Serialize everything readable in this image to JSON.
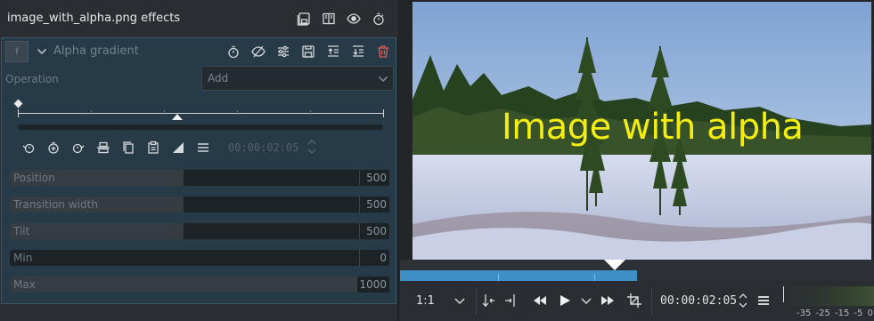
{
  "effects_panel": {
    "title": "image_with_alpha.png effects",
    "header_icons": [
      "save-stack-icon",
      "compare-split-icon",
      "visibility-eye-icon",
      "timer-icon"
    ],
    "effect": {
      "badge": "f",
      "name": "Alpha gradient",
      "row_icons": [
        "keyframe-timer-icon",
        "disable-eye-icon",
        "adjust-sliders-icon",
        "save-icon",
        "move-up-icon",
        "move-down-icon",
        "delete-icon"
      ],
      "operation_label": "Operation",
      "operation_value": "Add",
      "keyframe_timecode": "00:00:02:05",
      "keyframe_position": 0.43,
      "keyframe_tools": [
        "previous-keyframe-icon",
        "add-keyframe-icon",
        "next-keyframe-icon",
        "align-keyframe-icon",
        "copy-keyframe-icon",
        "paste-keyframe-icon",
        "interpolation-icon",
        "keyframe-menu-icon"
      ],
      "params": [
        {
          "label": "Position",
          "value": "500",
          "fill": 0.5
        },
        {
          "label": "Transition width",
          "value": "500",
          "fill": 0.5
        },
        {
          "label": "Tilt",
          "value": "500",
          "fill": 0.5
        },
        {
          "label": "Min",
          "value": "0",
          "fill": 0
        },
        {
          "label": "Max",
          "value": "1000",
          "fill": 1.0
        }
      ]
    }
  },
  "monitor": {
    "overlay_text": "Image with alpha",
    "timeline_position": 0.5,
    "zoom": "1:1",
    "timecode": "00:00:02:05",
    "audio_scale": "-35 -25 -15 -5 0"
  },
  "colors": {
    "accent": "#3d8fc6",
    "overlay_text": "#f4ee10",
    "delete": "#e05a5a"
  }
}
